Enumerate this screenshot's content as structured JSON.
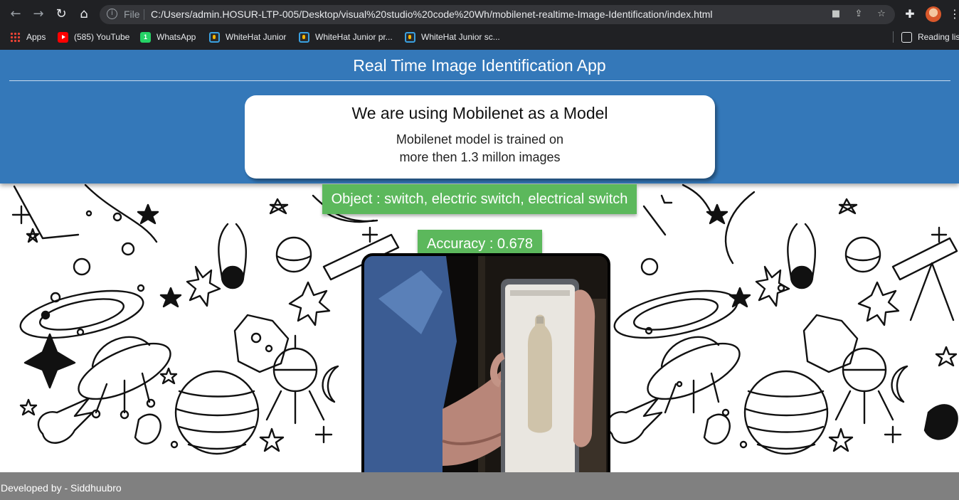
{
  "browser": {
    "url_scheme": "File",
    "url": "C:/Users/admin.HOSUR-LTP-005/Desktop/visual%20studio%20code%20Wh/mobilenet-realtime-Image-Identification/index.html",
    "icons": {
      "back": "back-arrow-icon",
      "forward": "forward-arrow-icon",
      "reload": "reload-icon",
      "home": "home-icon",
      "info": "info-icon",
      "camera": "camera-icon",
      "share": "share-icon",
      "star": "bookmark-star-icon",
      "extensions": "puzzle-icon",
      "menu": "kebab-menu-icon"
    },
    "bookmarks": [
      {
        "label": "Apps",
        "icon": "apps-grid-icon"
      },
      {
        "label": "(585) YouTube",
        "icon": "youtube-icon"
      },
      {
        "label": "WhatsApp",
        "icon": "whatsapp-icon"
      },
      {
        "label": "WhiteHat Junior",
        "icon": "whitehat-icon"
      },
      {
        "label": "WhiteHat Junior pr...",
        "icon": "whitehat-icon"
      },
      {
        "label": "WhiteHat Junior sc...",
        "icon": "whitehat-icon"
      }
    ],
    "reading_list": {
      "label": "Reading lis",
      "icon": "reading-list-icon"
    },
    "whatsapp_badge": "1"
  },
  "page": {
    "title": "Real Time Image Identification App",
    "card": {
      "heading": "We are using Mobilenet as a Model",
      "line1": "Mobilenet model is trained on",
      "line2": "more then 1.3 millon images"
    },
    "object_result": "Object : switch, electric switch, electrical switch",
    "accuracy_result": "Accuracy : 0.678",
    "footer": "Developed by - Siddhuubro"
  },
  "colors": {
    "header_blue": "#3478b9",
    "result_green": "#5cb85c",
    "footer_gray": "#808080",
    "chrome_dark": "#202124"
  }
}
